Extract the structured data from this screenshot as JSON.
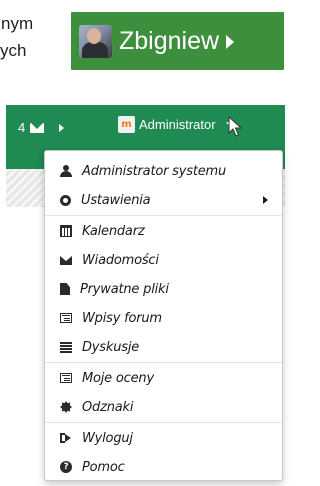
{
  "background_text": {
    "line1": "nym",
    "line2": "ych"
  },
  "user_badge": {
    "name": "Zbigniew",
    "color": "#3d8f3e"
  },
  "navbar": {
    "color": "#1f8a52",
    "message_count": "4",
    "user_menu_label": "Administrator",
    "logo_letter": "m"
  },
  "dropdown": {
    "items": [
      {
        "label": "Administrator systemu",
        "icon": "user-icon"
      },
      {
        "label": "Ustawienia",
        "icon": "gear-icon",
        "submenu": true
      },
      {
        "label": "Kalendarz",
        "icon": "calendar-icon"
      },
      {
        "label": "Wiadomości",
        "icon": "envelope-icon"
      },
      {
        "label": "Prywatne pliki",
        "icon": "file-icon"
      },
      {
        "label": "Wpisy forum",
        "icon": "list-alt-icon"
      },
      {
        "label": "Dyskusje",
        "icon": "list-icon"
      },
      {
        "label": "Moje oceny",
        "icon": "list-alt-icon"
      },
      {
        "label": "Odznaki",
        "icon": "badge-icon"
      },
      {
        "label": "Wyloguj",
        "icon": "sign-out-icon"
      },
      {
        "label": "Pomoc",
        "icon": "question-circle-icon"
      }
    ]
  }
}
